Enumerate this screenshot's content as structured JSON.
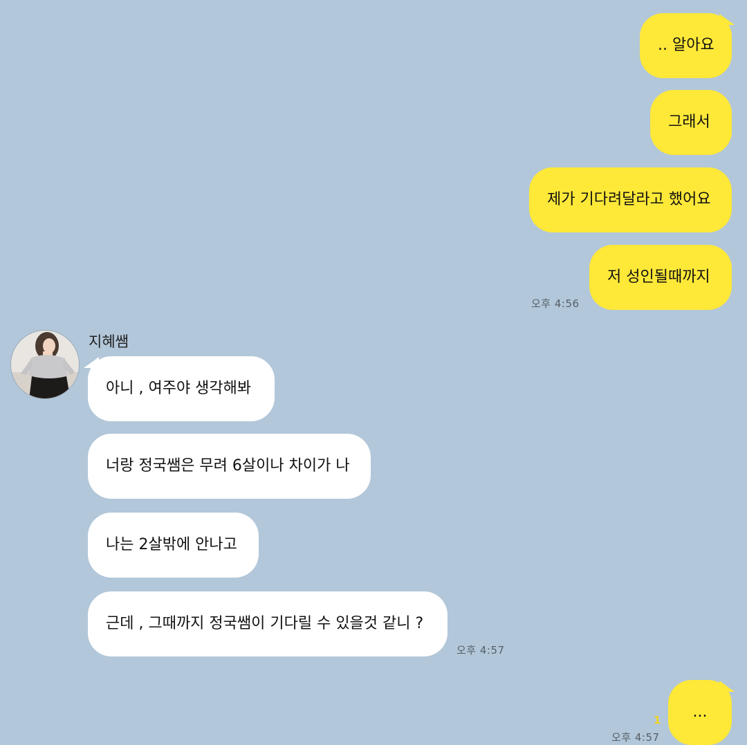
{
  "chat": {
    "partner_name": "지혜쌤",
    "my_messages_top": [
      {
        "text": ".. 알아요"
      },
      {
        "text": "그래서"
      },
      {
        "text": "제가 기다려달라고 했어요"
      },
      {
        "text": "저 성인될때까지"
      }
    ],
    "my_time_1": "오후 4:56",
    "their_messages": [
      {
        "text": "아니 , 여주야 생각해봐"
      },
      {
        "text": "너랑 정국쌤은 무려 6살이나 차이가 나"
      },
      {
        "text": "나는 2살밖에 안나고"
      },
      {
        "text": "근데 , 그때까지 정국쌤이 기다릴 수 있을것 같니 ?"
      }
    ],
    "their_time": "오후 4:57",
    "my_last_message": {
      "text": "...",
      "unread": "1",
      "time": "오후 4:57"
    }
  },
  "colors": {
    "background": "#b2c7d9",
    "my_bubble": "#fee838",
    "their_bubble": "#ffffff",
    "unread": "#f3d21e"
  },
  "icons": {
    "avatar": "profile-photo-avatar"
  }
}
